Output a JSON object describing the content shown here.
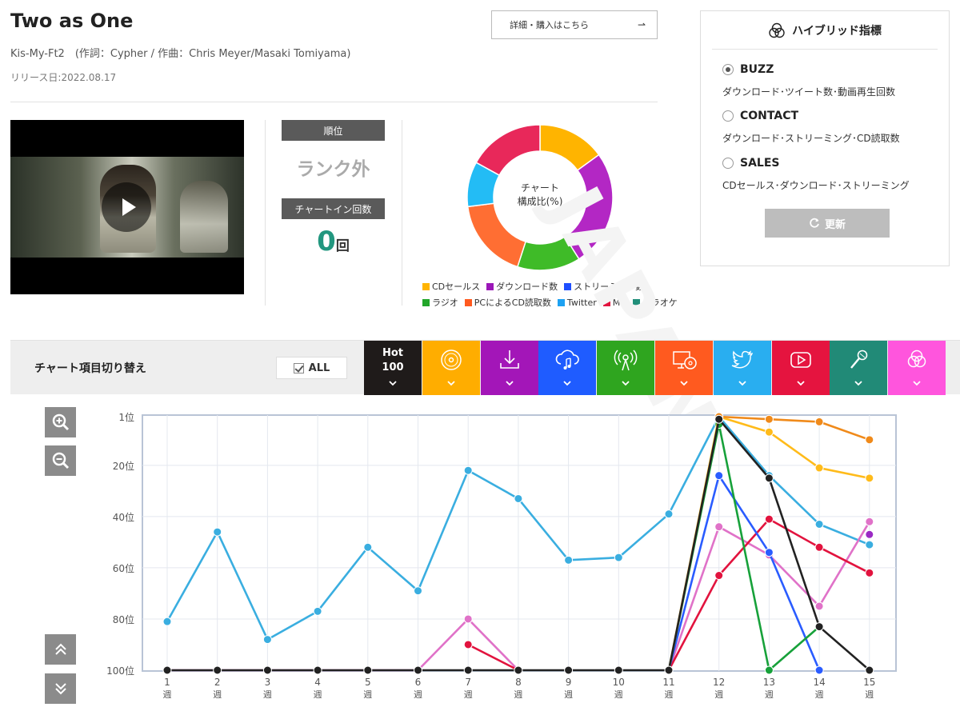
{
  "song": {
    "title": "Two as One",
    "credit": "Kis-My-Ft2　(作詞：Cypher / 作曲：Chris Meyer/Masaki Tomiyama)",
    "release": "リリース日:2022.08.17",
    "detail_button": "詳細・購入はこちら"
  },
  "rank": {
    "rank_label": "順位",
    "rank_value": "ランク外",
    "count_label": "チャートイン回数",
    "count_value": "0",
    "count_unit": "回"
  },
  "donut": {
    "center_line1": "チャート",
    "center_line2": "構成比(%)",
    "segments": [
      {
        "name": "CDセールス",
        "color": "#ffb400",
        "value": 15
      },
      {
        "name": "ダウンロード数",
        "color": "#b327c4",
        "value": 26
      },
      {
        "name": "ラジオ",
        "color": "#3fbb28",
        "value": 14
      },
      {
        "name": "PCによるCD読取数",
        "color": "#ff6e33",
        "value": 18
      },
      {
        "name": "Twitter",
        "color": "#23bcf5",
        "value": 10
      },
      {
        "name": "MV",
        "color": "#e8285a",
        "value": 17
      }
    ],
    "legend_row1": [
      {
        "label": "CDセールス",
        "color": "#ffb400"
      },
      {
        "label": "ダウンロード数",
        "color": "#9b17b8"
      },
      {
        "label": "ストリーミング数",
        "color": "#1f4fff"
      }
    ],
    "legend_row2": [
      {
        "label": "ラジオ",
        "color": "#22a62a"
      },
      {
        "label": "PCによるCD読取数",
        "color": "#ff5a1f"
      },
      {
        "label": "Twitter",
        "color": "#1da1f2"
      },
      {
        "label": "MV",
        "color": "#e2133e"
      },
      {
        "label": "カラオケ",
        "color": "#228f7a"
      }
    ]
  },
  "hybrid": {
    "title": "ハイブリッド指標",
    "options": [
      {
        "label": "BUZZ",
        "desc": "ダウンロード･ツイート数･動画再生回数",
        "selected": true
      },
      {
        "label": "CONTACT",
        "desc": "ダウンロード･ストリーミング･CD読取数",
        "selected": false
      },
      {
        "label": "SALES",
        "desc": "CDセールス･ダウンロード･ストリーミング",
        "selected": false
      }
    ],
    "update_button": "更新"
  },
  "watermark": "JAPAN",
  "switcher": {
    "title": "チャート項目切り替え",
    "all_label": "ALL",
    "tabs": [
      {
        "name": "hot100",
        "label_line1": "Hot",
        "label_line2": "100",
        "color": "#1f1b1a"
      },
      {
        "name": "cd-sales",
        "icon": "cd-icon",
        "color": "#ffad00"
      },
      {
        "name": "download",
        "icon": "download-icon",
        "color": "#a316b8"
      },
      {
        "name": "streaming",
        "icon": "cloud-music-icon",
        "color": "#1f5cff"
      },
      {
        "name": "radio",
        "icon": "radio-antenna-icon",
        "color": "#2fa51f"
      },
      {
        "name": "pc-cd-read",
        "icon": "pc-cd-icon",
        "color": "#ff5a1f"
      },
      {
        "name": "twitter",
        "icon": "twitter-icon",
        "color": "#29aef0"
      },
      {
        "name": "mv",
        "icon": "youtube-icon",
        "color": "#e5143f"
      },
      {
        "name": "karaoke",
        "icon": "microphone-icon",
        "color": "#218a77"
      },
      {
        "name": "hybrid",
        "icon": "hybrid-icon",
        "color": "#ff55dd"
      }
    ]
  },
  "chart_data": {
    "type": "line",
    "ylim": [
      1,
      100
    ],
    "y_reversed": true,
    "y_ticks": [
      1,
      20,
      40,
      60,
      80,
      100
    ],
    "y_tick_labels": [
      "1位",
      "20位",
      "40位",
      "60位",
      "80位",
      "100位"
    ],
    "x": [
      1,
      2,
      3,
      4,
      5,
      6,
      7,
      8,
      9,
      10,
      11,
      12,
      13,
      14,
      15
    ],
    "x_unit": "週",
    "series": [
      {
        "color": "#3aaee0",
        "values": [
          81,
          46,
          88,
          77,
          52,
          69,
          22,
          33,
          57,
          56,
          39,
          1,
          24,
          43,
          51
        ]
      },
      {
        "color": "#e072c8",
        "values": [
          100,
          100,
          100,
          100,
          100,
          100,
          80,
          100,
          null,
          null,
          100,
          44,
          55,
          75,
          42
        ]
      },
      {
        "color": "#e2133e",
        "values": [
          null,
          null,
          null,
          null,
          null,
          null,
          90,
          100,
          null,
          null,
          100,
          63,
          41,
          52,
          62
        ]
      },
      {
        "color": "#2a5cff",
        "values": [
          null,
          null,
          null,
          null,
          null,
          null,
          null,
          null,
          null,
          null,
          100,
          24,
          54,
          100,
          null
        ]
      },
      {
        "color": "#17a13a",
        "values": [
          null,
          null,
          null,
          null,
          null,
          null,
          null,
          null,
          null,
          null,
          100,
          4,
          100,
          83,
          null
        ]
      },
      {
        "color": "#ffbb1a",
        "values": [
          null,
          null,
          null,
          null,
          null,
          null,
          null,
          null,
          null,
          null,
          100,
          1,
          7,
          21,
          25
        ]
      },
      {
        "color": "#f08a1a",
        "values": [
          null,
          null,
          null,
          null,
          null,
          null,
          null,
          null,
          null,
          null,
          null,
          1,
          2,
          3,
          10
        ]
      },
      {
        "color": "#9b2ac4",
        "values": [
          null,
          null,
          null,
          null,
          null,
          null,
          null,
          null,
          null,
          null,
          null,
          null,
          null,
          null,
          47
        ]
      },
      {
        "color": "#222222",
        "values": [
          100,
          100,
          100,
          100,
          100,
          100,
          100,
          100,
          100,
          100,
          100,
          2,
          25,
          83,
          100
        ]
      }
    ]
  }
}
